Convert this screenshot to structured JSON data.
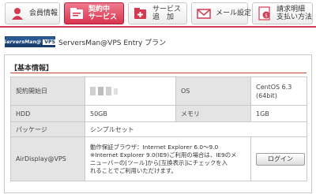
{
  "tabs": [
    {
      "label_lines": [
        "会員情報"
      ],
      "icon": "user-icon",
      "active": false
    },
    {
      "label_lines": [
        "契約中",
        "サービス"
      ],
      "icon": "contract-icon",
      "active": true
    },
    {
      "label_lines": [
        "サービス",
        "追　加"
      ],
      "icon": "add-service-icon",
      "active": false
    },
    {
      "label_lines": [
        "メール設定"
      ],
      "icon": "mail-icon",
      "active": false
    },
    {
      "label_lines": [
        "請求明細",
        "支払い方法"
      ],
      "icon": "billing-icon",
      "active": false
    }
  ],
  "colors": {
    "accent": "#d8344f",
    "section_line": "#c8443a",
    "key_cell": "#e4e4e4"
  },
  "plan": {
    "logo_main": "ServersMan@",
    "logo_suffix": "VPS",
    "title": "ServersMan@VPS Entry プラン"
  },
  "section": {
    "title": "【基本情報】"
  },
  "info": {
    "contract_start_label": "契約開始日",
    "os_label": "OS",
    "os_value_line1": "CentOS 6.3",
    "os_value_line2": "(64bit)",
    "hdd_label": "HDD",
    "hdd_value": "50GB",
    "memory_label": "メモリ",
    "memory_value": "1GB",
    "package_label": "パッケージ",
    "package_value": "シンプルセット",
    "airdisplay_label": "AirDisplay@VPS",
    "airdisplay_note_lines": [
      "動作保証ブラウザ：Internet Explorer 6.0〜9.0",
      "※Internet Explorer 9.0(IE9)ご利用の場合は、IE9のメ",
      "ニューバーの[ツール]から[互換表示]にチェックを入",
      "れることでご利用いただけます。"
    ],
    "login_button": "ログイン"
  }
}
